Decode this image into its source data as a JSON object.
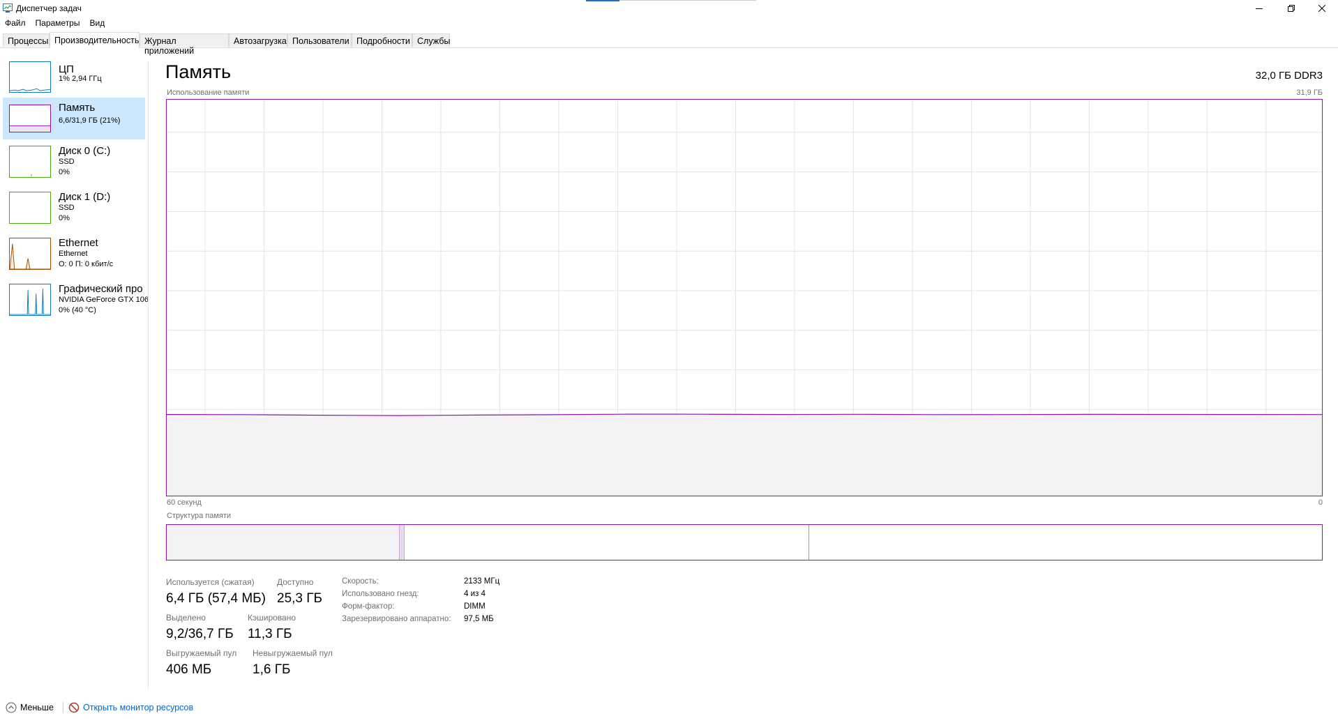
{
  "window": {
    "title": "Диспетчер задач",
    "icon": "task-manager-icon",
    "accent": "#1e6fc8",
    "caption_icons": [
      "minimize-icon",
      "restore-icon",
      "close-icon"
    ]
  },
  "menu": [
    "Файл",
    "Параметры",
    "Вид"
  ],
  "tabs": [
    {
      "label": "Процессы",
      "active": false
    },
    {
      "label": "Производительность",
      "active": true
    },
    {
      "label": "Журнал приложений",
      "active": false
    },
    {
      "label": "Автозагрузка",
      "active": false
    },
    {
      "label": "Пользователи",
      "active": false
    },
    {
      "label": "Подробности",
      "active": false
    },
    {
      "label": "Службы",
      "active": false
    }
  ],
  "sidebar": {
    "items": [
      {
        "title": "ЦП",
        "lines": [
          "1% 2,94 ГГц"
        ],
        "color": "#117dbb",
        "selected": false
      },
      {
        "title": "Память",
        "lines": [
          "6,6/31,9 ГБ (21%)"
        ],
        "color": "#8b12ae",
        "selected": true
      },
      {
        "title": "Диск 0 (C:)",
        "lines": [
          "SSD",
          "0%"
        ],
        "color": "#4da60c",
        "selected": false
      },
      {
        "title": "Диск 1 (D:)",
        "lines": [
          "SSD",
          "0%"
        ],
        "color": "#4da60c",
        "selected": false
      },
      {
        "title": "Ethernet",
        "lines": [
          "Ethernet",
          "О: 0 П: 0 кбит/с"
        ],
        "color": "#a74f01",
        "selected": false
      },
      {
        "title": "Графический про",
        "lines": [
          "NVIDIA GeForce GTX 106",
          "0% (40 °C)"
        ],
        "color": "#117dbb",
        "selected": false
      }
    ]
  },
  "main": {
    "heading": "Память",
    "spec": "32,0 ГБ DDR3",
    "usage_label": "Использование памяти",
    "usage_max": "31,9 ГБ",
    "time_left": "60 секунд",
    "time_right": "0",
    "structure_label": "Структура памяти",
    "usage_fraction": 0.205,
    "structure_fractions": {
      "in_use": 0.2,
      "modified": 0.006,
      "standby": 0.35
    },
    "graph_color": "#8b12ae",
    "fill_color": "#f4f2f4",
    "stats": [
      {
        "label": "Используется (сжатая)",
        "value": "6,4 ГБ (57,4 МБ)"
      },
      {
        "label": "Доступно",
        "value": "25,3 ГБ"
      },
      {
        "label": "Выделено",
        "value": "9,2/36,7 ГБ"
      },
      {
        "label": "Кэшировано",
        "value": "11,3 ГБ"
      },
      {
        "label": "Выгружаемый пул",
        "value": "406 МБ"
      },
      {
        "label": "Невыгружаемый пул",
        "value": "1,6 ГБ"
      }
    ],
    "properties": [
      {
        "label": "Скорость:",
        "value": "2133 МГц"
      },
      {
        "label": "Использовано гнезд:",
        "value": "4 из 4"
      },
      {
        "label": "Форм-фактор:",
        "value": "DIMM"
      },
      {
        "label": "Зарезервировано аппаратно:",
        "value": "97,5 МБ"
      }
    ]
  },
  "footer": {
    "less_label": "Меньше",
    "less_icon": "chevron-up-circle-icon",
    "monitor_label": "Открыть монитор ресурсов",
    "monitor_icon": "resource-monitor-icon"
  }
}
